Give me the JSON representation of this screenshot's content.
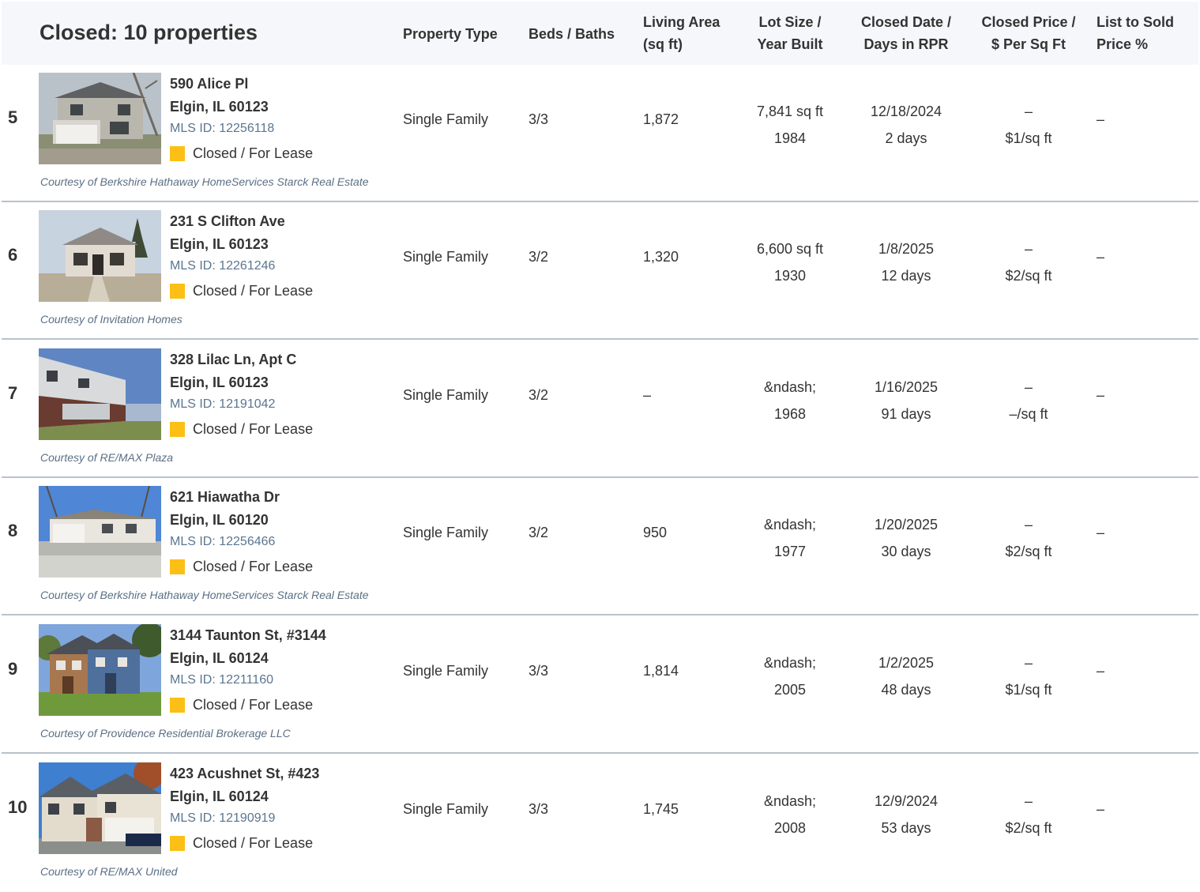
{
  "header": {
    "title": "Closed: 10 properties",
    "columns": {
      "property_type": "Property Type",
      "beds_baths": "Beds / Baths",
      "living_area_1": "Living Area",
      "living_area_2": "(sq ft)",
      "lot_size_1": "Lot Size /",
      "lot_size_2": "Year Built",
      "closed_date_1": "Closed Date /",
      "closed_date_2": "Days in RPR",
      "closed_price_1": "Closed Price /",
      "closed_price_2": "$ Per Sq Ft",
      "list_to_sold_1": "List to Sold",
      "list_to_sold_2": "Price %"
    }
  },
  "colors": {
    "header_bg": "#f5f7fa",
    "status_square": "#fbbf16",
    "mls_text": "#5a7590",
    "divider": "#b8c2cc"
  },
  "rows": [
    {
      "num": "5",
      "address1": "590 Alice Pl",
      "address2": "Elgin, IL 60123",
      "mls": "MLS ID: 12256118",
      "status": "Closed / For Lease",
      "courtesy": "Courtesy of Berkshire Hathaway HomeServices Starck Real Estate",
      "type": "Single Family",
      "beds_baths": "3/3",
      "living_area": "1,872",
      "lot_size": "7,841 sq ft",
      "year_built": "1984",
      "closed_date": "12/18/2024",
      "days": "2 days",
      "closed_price": "–",
      "per_sqft": "$1/sq ft",
      "list_to_sold": "–",
      "photo": "two-story-house-icon"
    },
    {
      "num": "6",
      "address1": "231 S Clifton Ave",
      "address2": "Elgin, IL 60123",
      "mls": "MLS ID: 12261246",
      "status": "Closed / For Lease",
      "courtesy": "Courtesy of Invitation Homes",
      "type": "Single Family",
      "beds_baths": "3/2",
      "living_area": "1,320",
      "lot_size": "6,600 sq ft",
      "year_built": "1930",
      "closed_date": "1/8/2025",
      "days": "12 days",
      "closed_price": "–",
      "per_sqft": "$2/sq ft",
      "list_to_sold": "–",
      "photo": "bungalow-icon"
    },
    {
      "num": "7",
      "address1": "328 Lilac Ln, Apt C",
      "address2": "Elgin, IL 60123",
      "mls": "MLS ID: 12191042",
      "status": "Closed / For Lease",
      "courtesy": "Courtesy of RE/MAX Plaza",
      "type": "Single Family",
      "beds_baths": "3/2",
      "living_area": "–",
      "lot_size": "&ndash;",
      "year_built": "1968",
      "closed_date": "1/16/2025",
      "days": "91 days",
      "closed_price": "–",
      "per_sqft": "–/sq ft",
      "list_to_sold": "–",
      "photo": "townhouse-icon"
    },
    {
      "num": "8",
      "address1": "621 Hiawatha Dr",
      "address2": "Elgin, IL 60120",
      "mls": "MLS ID: 12256466",
      "status": "Closed / For Lease",
      "courtesy": "Courtesy of Berkshire Hathaway HomeServices Starck Real Estate",
      "type": "Single Family",
      "beds_baths": "3/2",
      "living_area": "950",
      "lot_size": "&ndash;",
      "year_built": "1977",
      "closed_date": "1/20/2025",
      "days": "30 days",
      "closed_price": "–",
      "per_sqft": "$2/sq ft",
      "list_to_sold": "–",
      "photo": "ranch-house-icon"
    },
    {
      "num": "9",
      "address1": "3144 Taunton St, #3144",
      "address2": "Elgin, IL 60124",
      "mls": "MLS ID: 12211160",
      "status": "Closed / For Lease",
      "courtesy": "Courtesy of Providence Residential Brokerage LLC",
      "type": "Single Family",
      "beds_baths": "3/3",
      "living_area": "1,814",
      "lot_size": "&ndash;",
      "year_built": "2005",
      "closed_date": "1/2/2025",
      "days": "48 days",
      "closed_price": "–",
      "per_sqft": "$1/sq ft",
      "list_to_sold": "–",
      "photo": "row-townhome-icon"
    },
    {
      "num": "10",
      "address1": "423 Acushnet St, #423",
      "address2": "Elgin, IL 60124",
      "mls": "MLS ID: 12190919",
      "status": "Closed / For Lease",
      "courtesy": "Courtesy of RE/MAX United",
      "type": "Single Family",
      "beds_baths": "3/3",
      "living_area": "1,745",
      "lot_size": "&ndash;",
      "year_built": "2008",
      "closed_date": "12/9/2024",
      "days": "53 days",
      "closed_price": "–",
      "per_sqft": "$2/sq ft",
      "list_to_sold": "–",
      "photo": "garage-townhome-icon"
    }
  ]
}
